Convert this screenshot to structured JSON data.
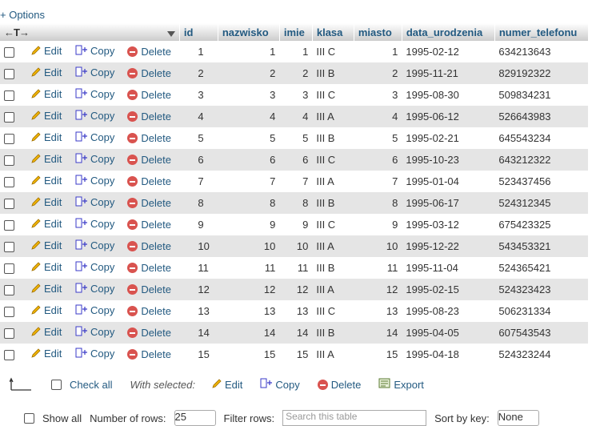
{
  "options_label": "+ Options",
  "columns": [
    "id",
    "nazwisko",
    "imie",
    "klasa",
    "miasto",
    "data_urodzenia",
    "numer_telefonu"
  ],
  "actions": {
    "edit": "Edit",
    "copy": "Copy",
    "delete": "Delete"
  },
  "rows": [
    {
      "id": "1",
      "nazwisko": "1",
      "imie": "1",
      "klasa": "III C",
      "miasto": "1",
      "data_urodzenia": "1995-02-12",
      "numer_telefonu": "634213643"
    },
    {
      "id": "2",
      "nazwisko": "2",
      "imie": "2",
      "klasa": "III B",
      "miasto": "2",
      "data_urodzenia": "1995-11-21",
      "numer_telefonu": "829192322"
    },
    {
      "id": "3",
      "nazwisko": "3",
      "imie": "3",
      "klasa": "III C",
      "miasto": "3",
      "data_urodzenia": "1995-08-30",
      "numer_telefonu": "509834231"
    },
    {
      "id": "4",
      "nazwisko": "4",
      "imie": "4",
      "klasa": "III A",
      "miasto": "4",
      "data_urodzenia": "1995-06-12",
      "numer_telefonu": "526643983"
    },
    {
      "id": "5",
      "nazwisko": "5",
      "imie": "5",
      "klasa": "III B",
      "miasto": "5",
      "data_urodzenia": "1995-02-21",
      "numer_telefonu": "645543234"
    },
    {
      "id": "6",
      "nazwisko": "6",
      "imie": "6",
      "klasa": "III C",
      "miasto": "6",
      "data_urodzenia": "1995-10-23",
      "numer_telefonu": "643212322"
    },
    {
      "id": "7",
      "nazwisko": "7",
      "imie": "7",
      "klasa": "III A",
      "miasto": "7",
      "data_urodzenia": "1995-01-04",
      "numer_telefonu": "523437456"
    },
    {
      "id": "8",
      "nazwisko": "8",
      "imie": "8",
      "klasa": "III B",
      "miasto": "8",
      "data_urodzenia": "1995-06-17",
      "numer_telefonu": "524312345"
    },
    {
      "id": "9",
      "nazwisko": "9",
      "imie": "9",
      "klasa": "III C",
      "miasto": "9",
      "data_urodzenia": "1995-03-12",
      "numer_telefonu": "675423325"
    },
    {
      "id": "10",
      "nazwisko": "10",
      "imie": "10",
      "klasa": "III A",
      "miasto": "10",
      "data_urodzenia": "1995-12-22",
      "numer_telefonu": "543453321"
    },
    {
      "id": "11",
      "nazwisko": "11",
      "imie": "11",
      "klasa": "III B",
      "miasto": "11",
      "data_urodzenia": "1995-11-04",
      "numer_telefonu": "524365421"
    },
    {
      "id": "12",
      "nazwisko": "12",
      "imie": "12",
      "klasa": "III A",
      "miasto": "12",
      "data_urodzenia": "1995-02-15",
      "numer_telefonu": "524323423"
    },
    {
      "id": "13",
      "nazwisko": "13",
      "imie": "13",
      "klasa": "III C",
      "miasto": "13",
      "data_urodzenia": "1995-08-23",
      "numer_telefonu": "506231334"
    },
    {
      "id": "14",
      "nazwisko": "14",
      "imie": "14",
      "klasa": "III B",
      "miasto": "14",
      "data_urodzenia": "1995-04-05",
      "numer_telefonu": "607543543"
    },
    {
      "id": "15",
      "nazwisko": "15",
      "imie": "15",
      "klasa": "III A",
      "miasto": "15",
      "data_urodzenia": "1995-04-18",
      "numer_telefonu": "524323244"
    }
  ],
  "bottom": {
    "check_all": "Check all",
    "with_selected": "With selected:",
    "edit": "Edit",
    "copy": "Copy",
    "delete": "Delete",
    "export": "Export"
  },
  "nav": {
    "show_all": "Show all",
    "num_rows_label": "Number of rows:",
    "rows_value": "25",
    "filter_label": "Filter rows:",
    "filter_placeholder": "Search this table",
    "sort_label": "Sort by key:",
    "sort_value": "None"
  },
  "colors": {
    "accent": "#235a81",
    "row_alt": "#e5e5e5",
    "delete": "#d9534f"
  }
}
